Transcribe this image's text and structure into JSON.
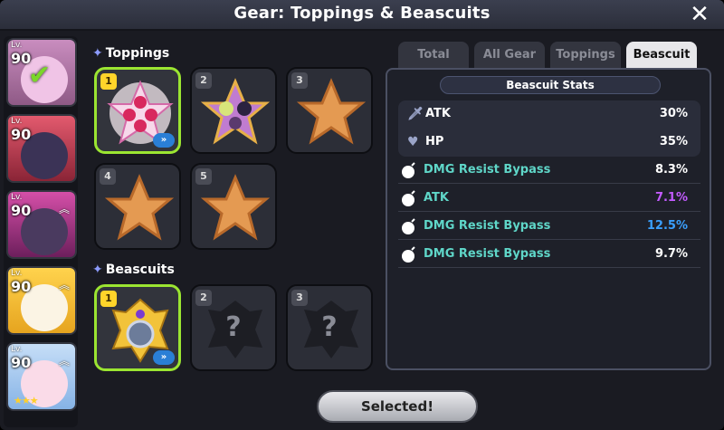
{
  "window": {
    "title": "Gear: Toppings & Beascuits",
    "close_icon": "close-icon"
  },
  "characters": [
    {
      "lv_prefix": "Lv.",
      "level": "90",
      "selected": true,
      "face_color": "#e7a7d9",
      "bg": "#b07aa8"
    },
    {
      "lv_prefix": "Lv.",
      "level": "90",
      "face_color": "#37304f",
      "bg": "#c33d52"
    },
    {
      "lv_prefix": "Lv.",
      "level": "90",
      "face_color": "#3d2e4f",
      "bg": "#b8338a"
    },
    {
      "lv_prefix": "Lv.",
      "level": "90",
      "face_color": "#f6f0e0",
      "bg": "#f3c53a"
    },
    {
      "lv_prefix": "Lv.",
      "level": "90",
      "face_color": "#f8d5e4",
      "bg": "#a6c8ee",
      "stars": "★★★"
    }
  ],
  "toppings": {
    "title": "Toppings",
    "slots": [
      {
        "num": "1",
        "boost": "»"
      },
      {
        "num": "2"
      },
      {
        "num": "3"
      },
      {
        "num": "4"
      },
      {
        "num": "5"
      }
    ]
  },
  "beascuits": {
    "title": "Beascuits",
    "slots": [
      {
        "num": "1",
        "boost": "»"
      },
      {
        "num": "2",
        "placeholder": "?"
      },
      {
        "num": "3",
        "placeholder": "?"
      }
    ]
  },
  "tabs": [
    {
      "label": "Total"
    },
    {
      "label": "All Gear"
    },
    {
      "label": "Toppings"
    },
    {
      "label": "Beascuit",
      "active": true
    }
  ],
  "stats": {
    "header": "Beascuit Stats",
    "main": [
      {
        "label": "ATK",
        "value": "30%",
        "icon": "sword-icon"
      },
      {
        "label": "HP",
        "value": "35%",
        "icon": "heart-icon"
      }
    ],
    "sub": [
      {
        "label": "DMG Resist Bypass",
        "value": "8.3%",
        "value_color": "#ffffff"
      },
      {
        "label": "ATK",
        "value": "7.1%",
        "value_color": "#c35bff"
      },
      {
        "label": "DMG Resist Bypass",
        "value": "12.5%",
        "value_color": "#3aa0ff"
      },
      {
        "label": "DMG Resist Bypass",
        "value": "9.7%",
        "value_color": "#ffffff"
      }
    ]
  },
  "footer": {
    "selected_label": "Selected!"
  },
  "colors": {
    "accent_green": "#9be531",
    "sub_stat_label": "#5fd6c8"
  }
}
